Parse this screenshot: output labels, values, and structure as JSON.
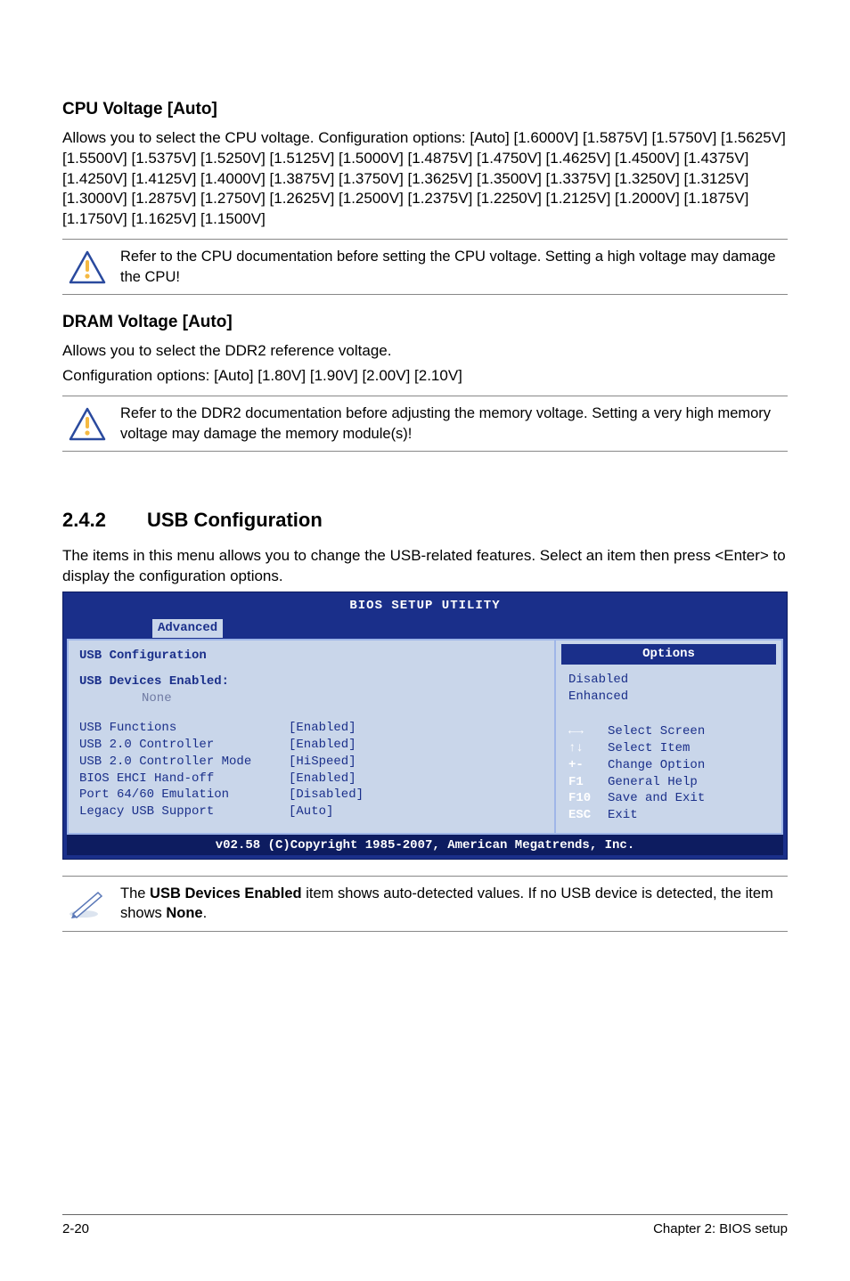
{
  "cpu": {
    "heading": "CPU Voltage [Auto]",
    "p1": "Allows you to select the CPU voltage. Configuration options: [Auto] [1.6000V] [1.5875V] [1.5750V] [1.5625V] [1.5500V] [1.5375V] [1.5250V] [1.5125V] [1.5000V] [1.4875V] [1.4750V] [1.4625V] [1.4500V] [1.4375V] [1.4250V] [1.4125V] [1.4000V] [1.3875V] [1.3750V] [1.3625V] [1.3500V] [1.3375V] [1.3250V] [1.3125V] [1.3000V] [1.2875V] [1.2750V] [1.2625V] [1.2500V] [1.2375V] [1.2250V] [1.2125V] [1.2000V] [1.1875V] [1.1750V] [1.1625V] [1.1500V]",
    "note": "Refer to the CPU documentation before setting the CPU voltage. Setting a high voltage may damage the CPU!"
  },
  "dram": {
    "heading": "DRAM Voltage [Auto]",
    "p1": "Allows you to select the DDR2 reference voltage.",
    "p2": "Configuration options: [Auto] [1.80V]  [1.90V] [2.00V] [2.10V]",
    "note": "Refer to the DDR2 documentation before adjusting the memory voltage. Setting a very high memory voltage may damage the memory module(s)!"
  },
  "usbSection": {
    "num": "2.4.2",
    "title": "USB Configuration",
    "intro": "The items in this menu allows you to change the USB-related features. Select an item then press <Enter> to display the configuration options."
  },
  "bios": {
    "title": "BIOS SETUP UTILITY",
    "tab": "Advanced",
    "leftHeader": "USB Configuration",
    "devEnabledLabel": "USB Devices Enabled:",
    "devEnabledValue": "None",
    "rows": [
      {
        "label": "USB Functions",
        "value": "[Enabled]"
      },
      {
        "label": "USB 2.0 Controller",
        "value": "[Enabled]"
      },
      {
        "label": "USB 2.0 Controller Mode",
        "value": "[HiSpeed]"
      },
      {
        "label": "BIOS EHCI Hand-off",
        "value": "[Enabled]"
      },
      {
        "label": "Port 64/60 Emulation",
        "value": "[Disabled]"
      },
      {
        "label": "Legacy USB Support",
        "value": "[Auto]"
      }
    ],
    "optionsTitle": "Options",
    "options": [
      "Disabled",
      "Enhanced"
    ],
    "help": [
      {
        "key": "←→",
        "text": "Select Screen"
      },
      {
        "key": "↑↓",
        "text": "Select Item"
      },
      {
        "key": "+-",
        "text": "Change Option"
      },
      {
        "key": "F1",
        "text": "General Help"
      },
      {
        "key": "F10",
        "text": "Save and Exit"
      },
      {
        "key": "ESC",
        "text": "Exit"
      }
    ],
    "footer": "v02.58 (C)Copyright 1985-2007, American Megatrends, Inc."
  },
  "usbNote": {
    "pre": "The ",
    "bold1": "USB Devices Enabled",
    "mid": " item shows auto-detected values. If no USB device is detected, the item shows ",
    "bold2": "None",
    "post": "."
  },
  "footer": {
    "left": "2-20",
    "right": "Chapter 2: BIOS setup"
  }
}
